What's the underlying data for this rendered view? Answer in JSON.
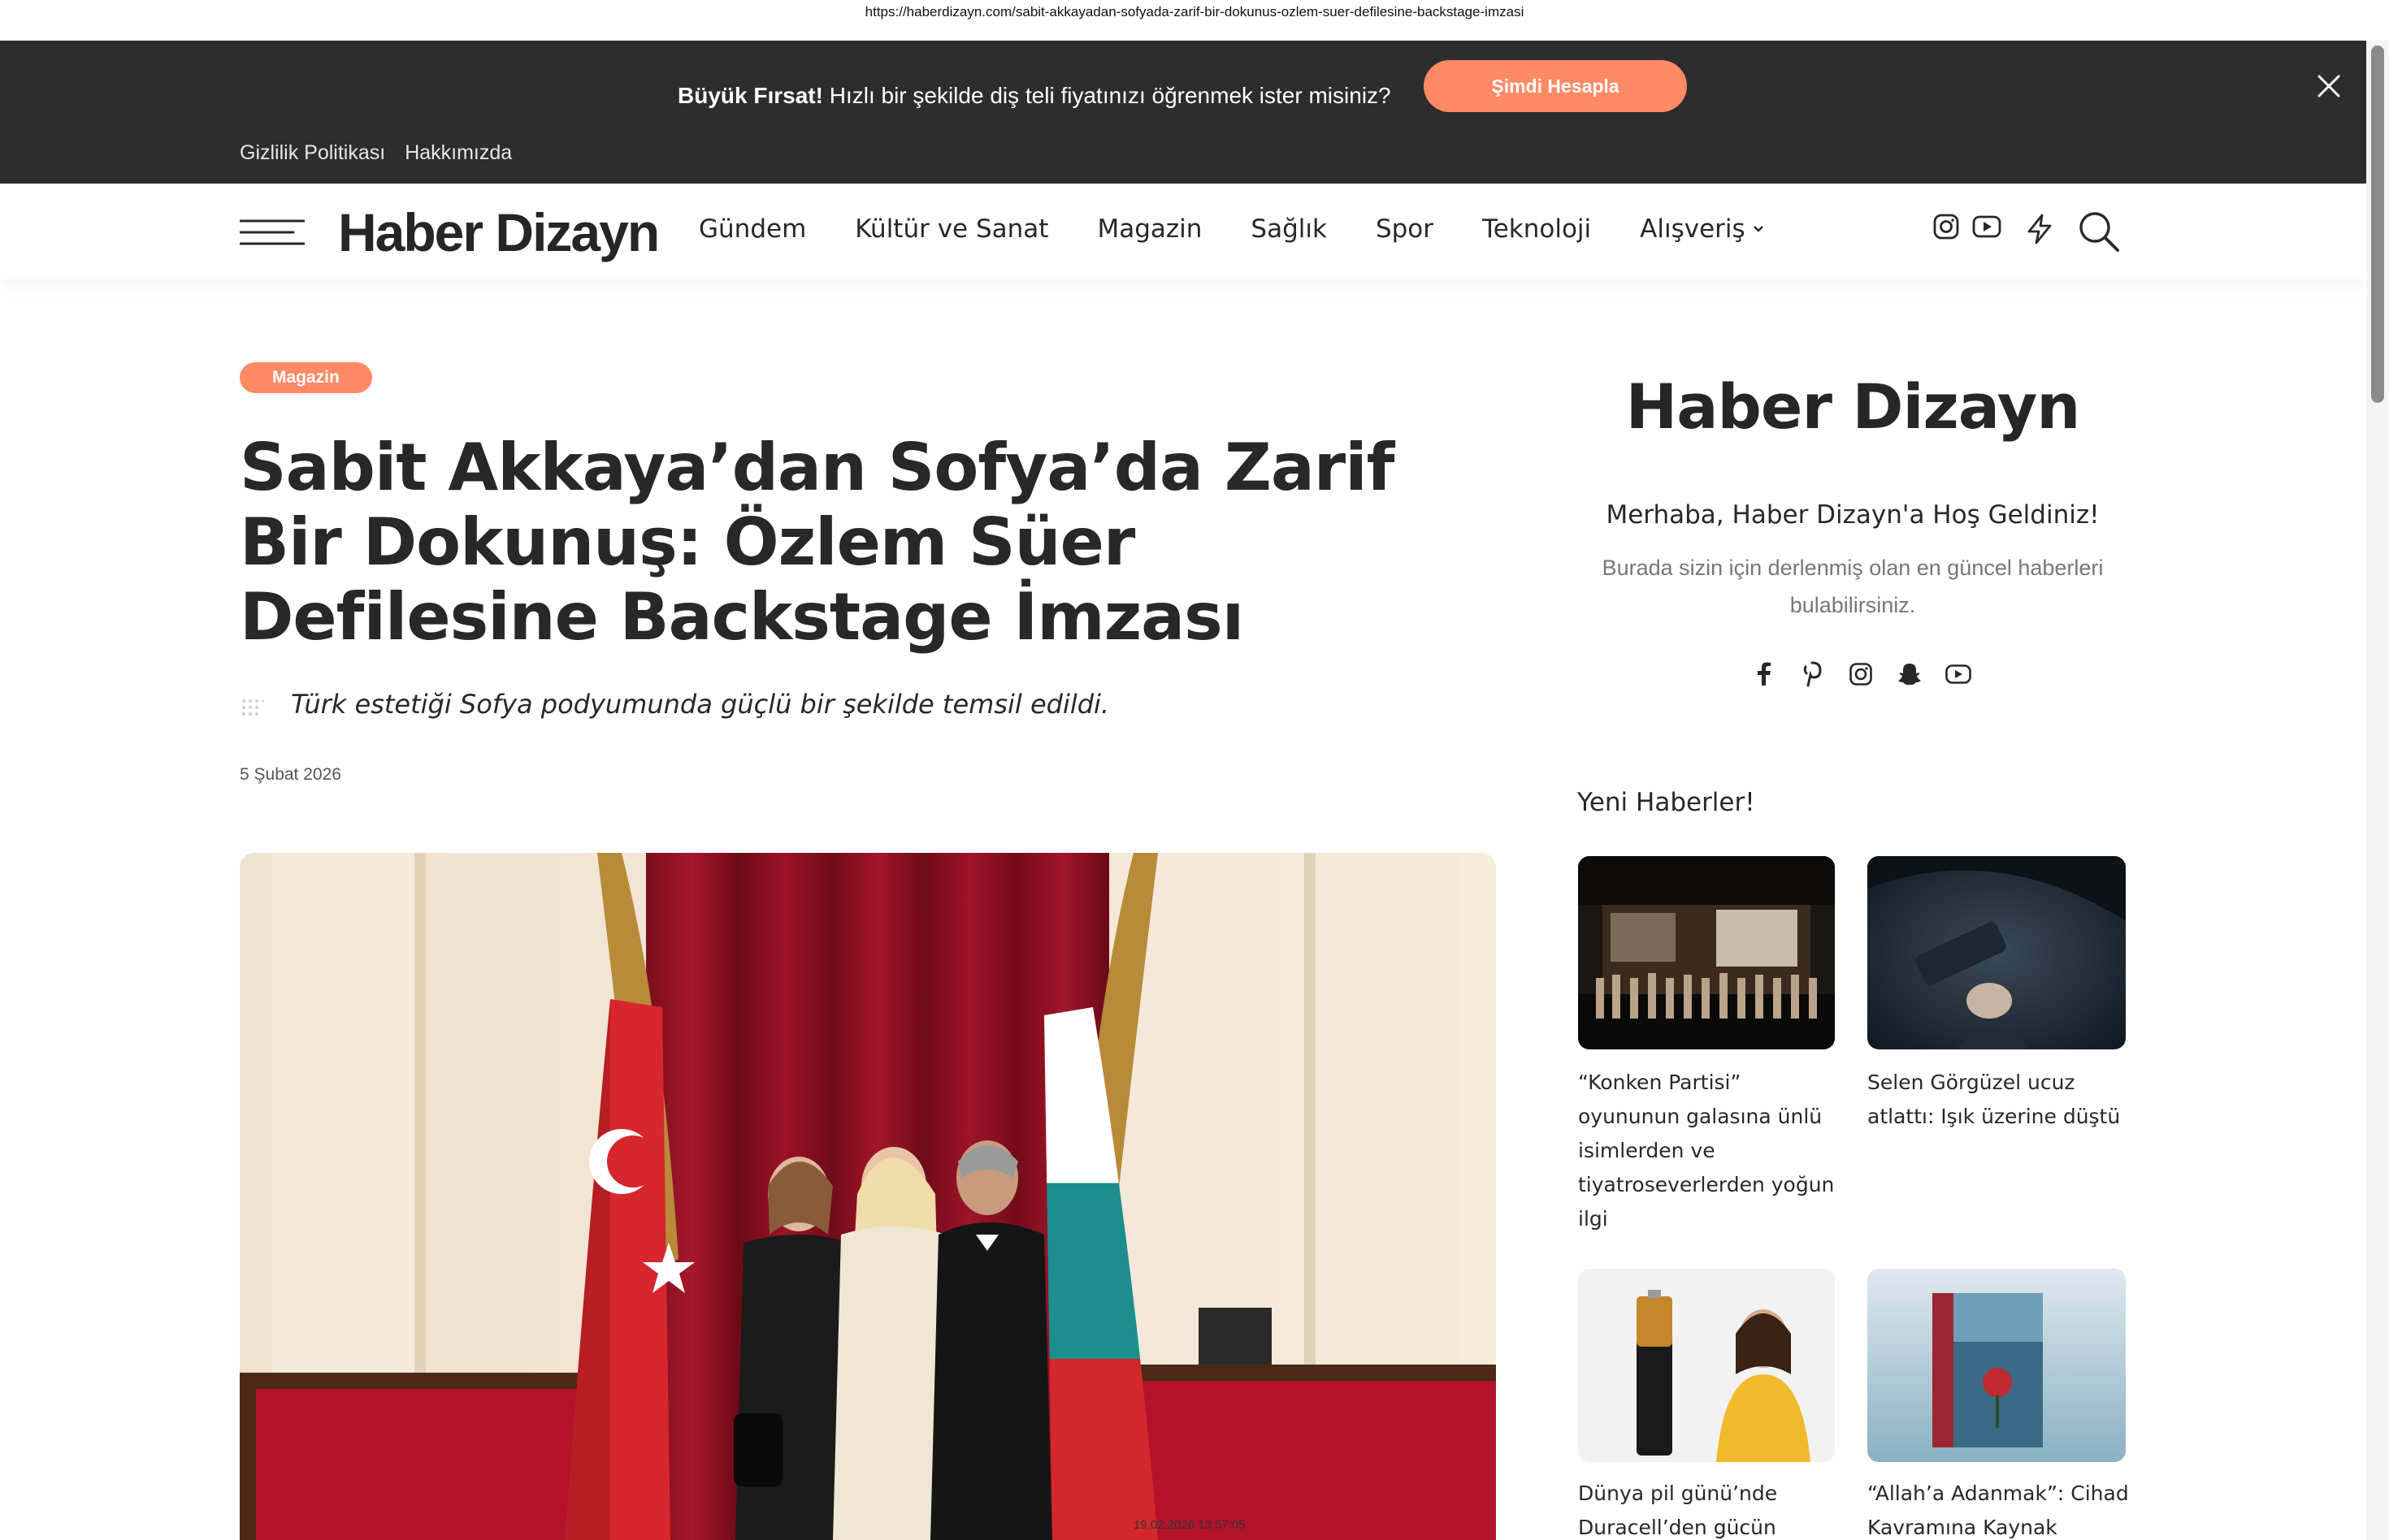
{
  "browser": {
    "url": "https://haberdizayn.com/sabit-akkayadan-sofyada-zarif-bir-dokunus-ozlem-suer-defilesine-backstage-imzasi"
  },
  "promo": {
    "bold": "Büyük Fırsat!",
    "text": " Hızlı bir şekilde diş teli fiyatınızı öğrenmek ister misiniz?",
    "button": "Şimdi Hesapla",
    "close_icon": "close-icon"
  },
  "top_links": [
    "Gizlilik Politikası",
    "Hakkımızda"
  ],
  "header": {
    "logo": "Haber Dizayn",
    "nav": [
      "Gündem",
      "Kültür ve Sanat",
      "Magazin",
      "Sağlık",
      "Spor",
      "Teknoloji",
      "Alışveriş"
    ],
    "icons": [
      "instagram-icon",
      "youtube-icon",
      "lightning-icon",
      "search-icon"
    ]
  },
  "article": {
    "category": "Magazin",
    "title": "Sabit Akkaya’dan Sofya’da Zarif Bir Dokunuş: Özlem Süer Defilesine Backstage İmzası",
    "lead": "Türk estetiği Sofya podyumunda güçlü bir şekilde temsil edildi.",
    "date": "5 Şubat 2026",
    "photo_stamp": "19.02.2026 13:57:05"
  },
  "sidebar": {
    "logo": "Haber Dizayn",
    "welcome": "Merhaba, Haber Dizayn'a Hoş Geldiniz!",
    "description": "Burada sizin için derlenmiş olan en güncel haberleri bulabilirsiniz.",
    "social": [
      "facebook-icon",
      "pinterest-icon",
      "instagram-icon",
      "snapchat-icon",
      "youtube-icon"
    ],
    "news_heading": "Yeni Haberler!",
    "news": [
      {
        "title": "“Konken Partisi” oyununun galasına ünlü isimlerden ve tiyatroseverlerden yoğun ilgi"
      },
      {
        "title": "Selen Görgüzel ucuz atlattı: Işık üzerine düştü"
      },
      {
        "title": "Dünya pil günü’nde Duracell’den gücün"
      },
      {
        "title": "“Allah’a Adanmak”: Cihad Kavramına Kaynak"
      }
    ]
  },
  "colors": {
    "accent": "#ff8a65",
    "dark_bar": "#2d2d2d",
    "text": "#282828"
  }
}
